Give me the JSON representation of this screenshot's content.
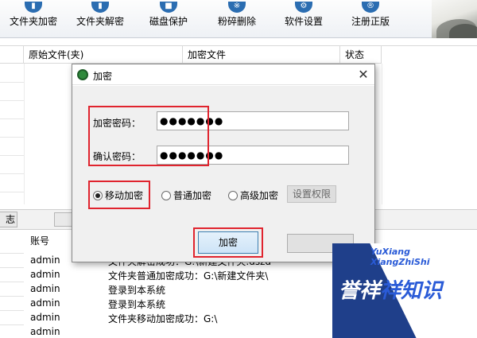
{
  "toolbar": {
    "buttons": [
      {
        "label": "文件夹加密",
        "icon": "folder-lock-icon"
      },
      {
        "label": "文件夹解密",
        "icon": "folder-unlock-icon"
      },
      {
        "label": "磁盘保护",
        "icon": "disk-shield-icon"
      },
      {
        "label": "粉碎删除",
        "icon": "shredder-icon"
      },
      {
        "label": "软件设置",
        "icon": "gear-icon"
      },
      {
        "label": "注册正版",
        "icon": "registered-icon"
      }
    ],
    "icon_glyphs": [
      "▮",
      "▮",
      "■",
      "※",
      "⚙",
      "®"
    ]
  },
  "upper_table": {
    "columns": [
      "原始文件(夹)",
      "加密文件",
      "状态"
    ]
  },
  "mid_strip": {
    "tab_label": "志"
  },
  "log_table": {
    "columns": [
      "账号"
    ],
    "rows": [
      {
        "account": "admin",
        "message": "文件夹解密成功：G:\\新建文件夹.dszd"
      },
      {
        "account": "admin",
        "message": "文件夹普通加密成功：G:\\新建文件夹\\"
      },
      {
        "account": "admin",
        "message": "登录到本系统"
      },
      {
        "account": "admin",
        "message": "登录到本系统"
      },
      {
        "account": "admin",
        "message": "文件夹移动加密成功：G:\\"
      }
    ]
  },
  "dialog": {
    "title": "加密",
    "close_glyph": "✕",
    "password_label": "加密密码：",
    "password_value": "●●●●●●●",
    "confirm_label": "确认密码：",
    "confirm_value": "●●●●●●●",
    "modes": [
      {
        "label": "移动加密",
        "selected": true
      },
      {
        "label": "普通加密",
        "selected": false
      },
      {
        "label": "高级加密",
        "selected": false
      }
    ],
    "permissions_button": "设置权限",
    "encrypt_button": "加密"
  },
  "watermark": {
    "line1": "YuXiang",
    "line2": "XiangZhiShi",
    "main_white": "誉祥",
    "main_blue": "祥知识"
  },
  "colors": {
    "highlight_red": "#e0242e",
    "accent_blue": "#2b6db1",
    "watermark_blue": "#1f3f8a"
  }
}
